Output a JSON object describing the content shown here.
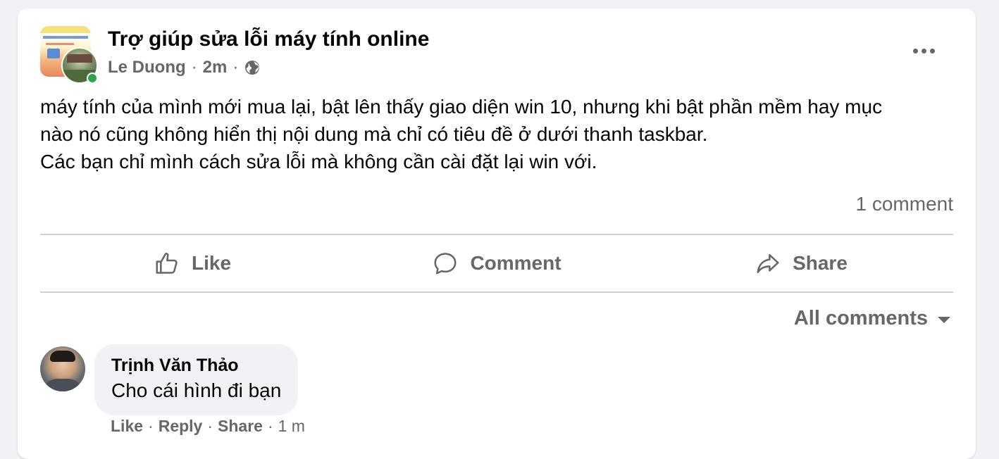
{
  "post": {
    "group_name": "Trợ giúp sửa lỗi máy tính online",
    "author": "Le Duong",
    "separator": "·",
    "time": "2m",
    "privacy_icon": "globe-icon",
    "more_icon": "more-options-icon",
    "text_lines": [
      "máy tính của mình mới mua lại, bật lên thấy giao diện win 10, nhưng khi bật phần mềm hay mục",
      "nào nó cũng không hiển thị nội dung mà chỉ có tiêu đề ở dưới thanh taskbar.",
      "Các bạn chỉ mình cách sửa lỗi mà không cần cài đặt lại win với."
    ],
    "comment_count": "1 comment"
  },
  "actions": {
    "like_label": "Like",
    "comment_label": "Comment",
    "share_label": "Share"
  },
  "comments_filter": {
    "label": "All comments"
  },
  "comment": {
    "author": "Trịnh Văn Thảo",
    "text": "Cho cái hình đi bạn",
    "like_label": "Like",
    "reply_label": "Reply",
    "share_label": "Share",
    "separator": "·",
    "time": "1 m"
  },
  "colors": {
    "background": "#f0f2f5",
    "card": "#ffffff",
    "secondary_text": "#65676b",
    "primary_text": "#050505",
    "online": "#31a24c",
    "divider": "#ced0d4"
  }
}
